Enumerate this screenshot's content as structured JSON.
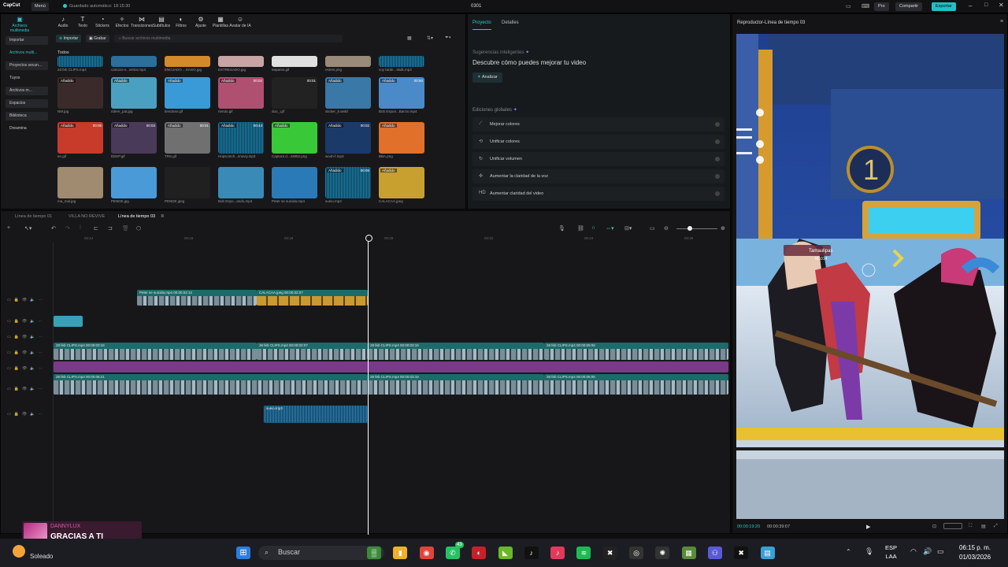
{
  "titlebar": {
    "logo": "CapCut",
    "menu": "Menú",
    "autosave": "Guardado automático: 18:15:30",
    "project": "0301",
    "pro": "Pro",
    "share": "Compartir",
    "export": "Exportar"
  },
  "toolbar": [
    {
      "icon": "media-icon",
      "label": "Archivos multimedia"
    },
    {
      "icon": "audio-icon",
      "label": "Audio"
    },
    {
      "icon": "text-icon",
      "label": "Texto"
    },
    {
      "icon": "sticker-icon",
      "label": "Stickers"
    },
    {
      "icon": "effects-icon",
      "label": "Efectos"
    },
    {
      "icon": "transitions-icon",
      "label": "Transiciones"
    },
    {
      "icon": "subtitles-icon",
      "label": "Subtítulos"
    },
    {
      "icon": "filters-icon",
      "label": "Filtros"
    },
    {
      "icon": "adjust-icon",
      "label": "Ajuste"
    },
    {
      "icon": "templates-icon",
      "label": "Plantillas"
    },
    {
      "icon": "ai-avatar-icon",
      "label": "Avatar de IA"
    }
  ],
  "sidenav": [
    "Importar",
    "Archivos multi...",
    "Proyectos secun...",
    "Tuyos",
    "Archivos m...",
    "Espacios",
    "Biblioteca",
    "Dreamina"
  ],
  "mediabar": {
    "import": "Importar",
    "record": "Grabar",
    "search_placeholder": "Buscar archivos multimedia",
    "all": "Todos"
  },
  "media_items": [
    {
      "name": "2d feb CLIPS.mp4",
      "badge": "",
      "dur": ""
    },
    {
      "name": "cartoon-n...vertar.mp3",
      "badge": "",
      "dur": ""
    },
    {
      "name": "ENOJADO ...SAGO.jpg",
      "badge": "",
      "dur": ""
    },
    {
      "name": "ESTRESADO.jpg",
      "badge": "",
      "dur": ""
    },
    {
      "name": "eepanto.gif",
      "badge": "",
      "dur": ""
    },
    {
      "name": "estres.png",
      "badge": "",
      "dur": ""
    },
    {
      "name": "voy tarde...4kdk.mp3",
      "badge": "",
      "dur": ""
    },
    {
      "name": "NM.jpg",
      "badge": "Añadido",
      "dur": ""
    },
    {
      "name": "ridere_pat.jpg",
      "badge": "Añadido",
      "dur": ""
    },
    {
      "name": "tiendose.gif",
      "badge": "Añadido",
      "dur": ""
    },
    {
      "name": "riendo.gif",
      "badge": "Añadido",
      "dur": "00:02"
    },
    {
      "name": "duo_.gif",
      "badge": "",
      "dur": "00:01"
    },
    {
      "name": "sticker_5.webf",
      "badge": "Añadido",
      "dur": ""
    },
    {
      "name": "Bob Espon...Barcio.mp4",
      "badge": "Añadido",
      "dur": "00:50"
    },
    {
      "name": "en.gif",
      "badge": "Añadido",
      "dur": "00:05"
    },
    {
      "name": "DEEP.gif",
      "badge": "Añadido",
      "dur": "00:03"
    },
    {
      "name": "TRS.gif",
      "badge": "Añadido",
      "dur": "00:01"
    },
    {
      "name": "Hopscotch...imoviy.mp3",
      "badge": "Añadido",
      "dur": "00:44"
    },
    {
      "name": "Captura d...43952.png",
      "badge": "Añadido",
      "dur": ""
    },
    {
      "name": "wooh-f.mp3",
      "badge": "Añadido",
      "dur": "00:02"
    },
    {
      "name": "BBA.png",
      "badge": "Añadido",
      "dur": ""
    },
    {
      "name": "ma_mal.jpg",
      "badge": "",
      "dur": ""
    },
    {
      "name": "PENDE.jpg",
      "badge": "",
      "dur": ""
    },
    {
      "name": "PENDE.jpeg",
      "badge": "",
      "dur": ""
    },
    {
      "name": "Bob Espo...ando.mp4",
      "badge": "",
      "dur": ""
    },
    {
      "name": "Peter se suicida.mp4",
      "badge": "",
      "dur": ""
    },
    {
      "name": "sueio.mp3",
      "badge": "Añadido",
      "dur": "00:06"
    },
    {
      "name": "CALACAA.jpeg",
      "badge": "Añadido",
      "dur": ""
    }
  ],
  "props": {
    "tab1": "Proyecto",
    "tab2": "Detalles",
    "smart": "Sugerencias inteligentes",
    "smart2": "Descubre cómo puedes mejorar tu video",
    "analyze": "Analizar",
    "global": "Ediciones globales",
    "items": [
      {
        "icon": "wand-icon",
        "label": "Mejorar colores"
      },
      {
        "icon": "palette-icon",
        "label": "Unificar colores"
      },
      {
        "icon": "volume-icon",
        "label": "Unificar volumen"
      },
      {
        "icon": "voice-icon",
        "label": "Aumentar la claridad de la voz"
      },
      {
        "icon": "hd-icon",
        "label": "Aumentar claridad del video"
      }
    ]
  },
  "player": {
    "title": "Reproductor-Línea de tiempo 03",
    "current": "00:00:19:20",
    "total": "00:00:39:07",
    "hud_name": "Tamaulipas",
    "hud_sub": "M1014",
    "hud_number": "1"
  },
  "timeline": {
    "tabs": [
      "Línea de tiempo 01",
      "VILLA NO REVIVE",
      "Línea de tiempo 03"
    ],
    "ruler": [
      "00:14",
      "00:16",
      "00:18",
      "00:20",
      "00:22",
      "00:24",
      "00:26"
    ],
    "clips": {
      "top1": "Peter se suicida.mp4  00:00:02:12",
      "top2": "CALACAA.jpeg  00:00:02:07",
      "main_a": [
        "28 feb CLIPS.mp4  00:00:03:16",
        "28 feb CLIPS.mp4  00:00:02:07",
        "28 feb CLIPS.mp4  00:00:03:16",
        "28 feb CLIPS.mp4  00:00:05:06"
      ],
      "main_b": [
        "28 feb CLIPS.mp4  00:00:06:21",
        "28 feb CLIPS.mp4  00:00:03:16",
        "28 feb CLIPS.mp4  00:00:05:06"
      ],
      "audio": "sueio.mp3"
    }
  },
  "notification": {
    "user": "DANNYLUX",
    "text": "GRACIAS A TI"
  },
  "taskbar": {
    "weather": "Soleado",
    "search": "Buscar",
    "lang1": "ESP",
    "lang2": "LAA",
    "time": "06:15 p. m.",
    "date": "01/03/2026",
    "badge": "43"
  },
  "colors": {
    "accent": "#2ec7c7",
    "clip_teal": "#1d6a6a",
    "audio_purple": "#7a3a8a"
  }
}
